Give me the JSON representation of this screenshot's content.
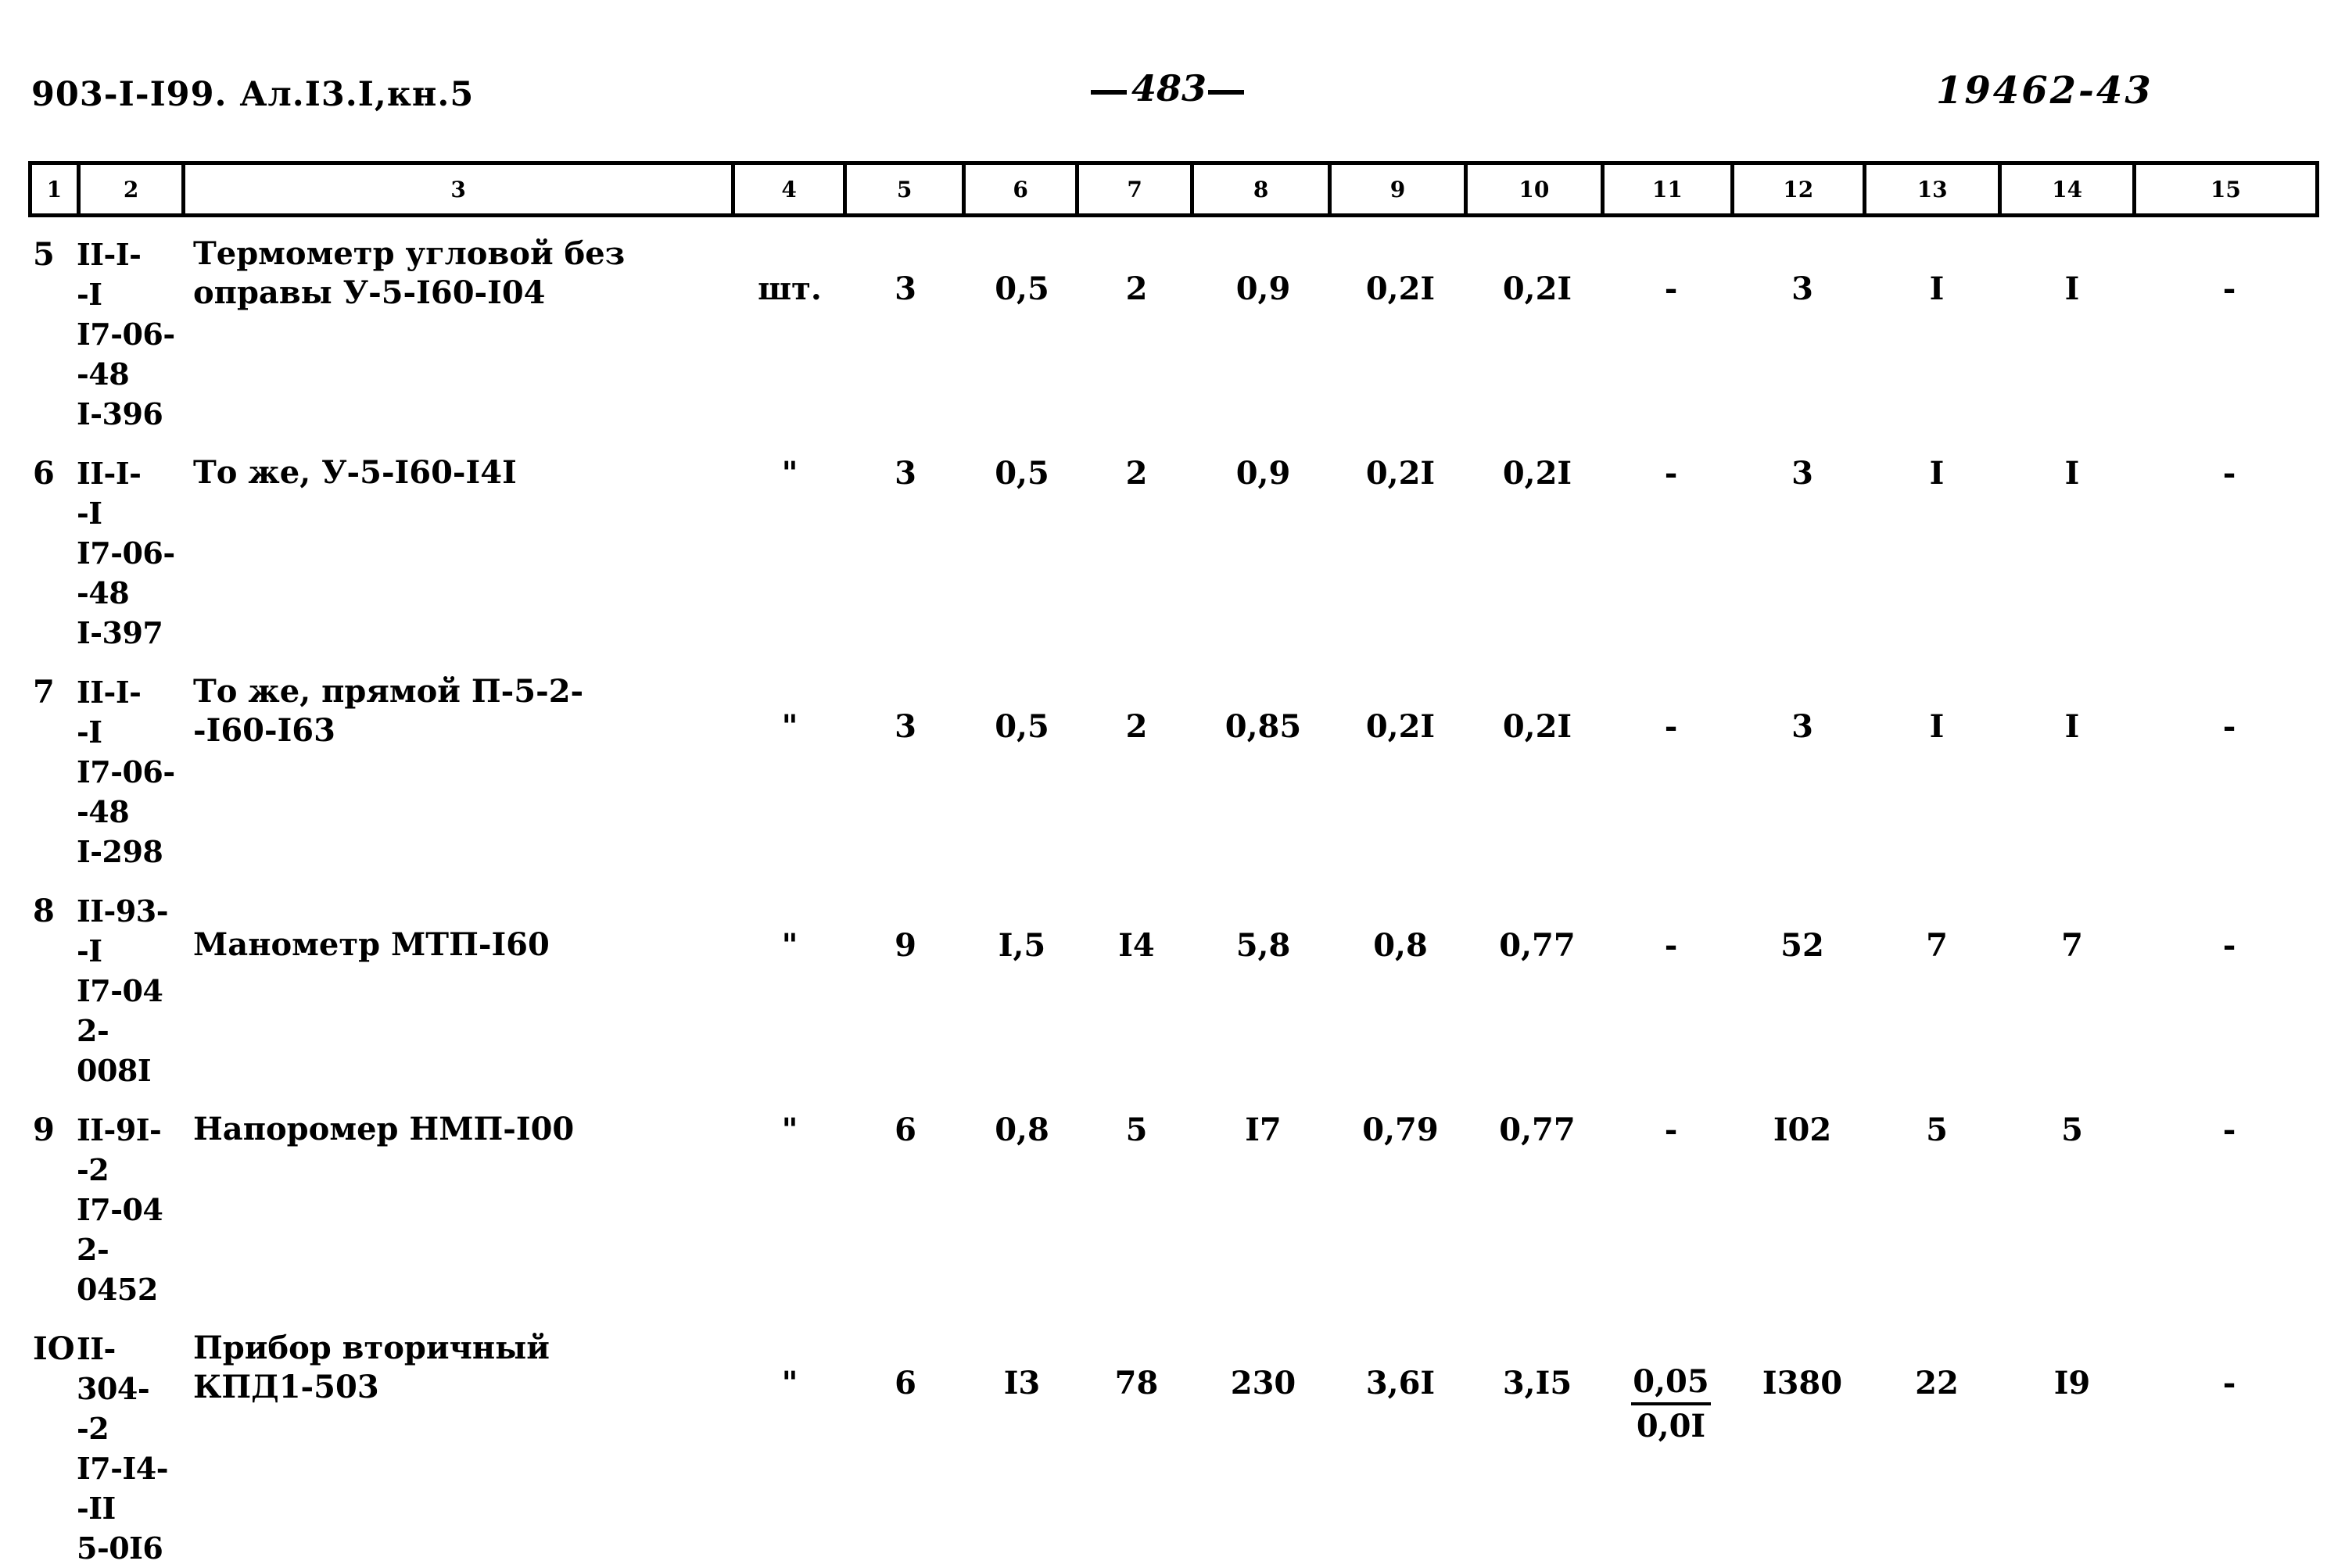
{
  "header": {
    "doc_code": "903-I-I99. Ал.I3.I,кн.5",
    "page_number": "483",
    "archive_number": "19462-43"
  },
  "table": {
    "column_headers": [
      "1",
      "2",
      "3",
      "4",
      "5",
      "6",
      "7",
      "8",
      "9",
      "10",
      "11",
      "12",
      "13",
      "14",
      "15"
    ],
    "rows": [
      {
        "pos": "5",
        "code": "II-I-\n-I\nI7-06-\n-48\nI-396",
        "name": "Термометр угловой без\nоправы У-5-I60-I04",
        "unit": "шт.",
        "c5": "3",
        "c6": "0,5",
        "c7": "2",
        "c8": "0,9",
        "c9": "0,2I",
        "c10": "0,2I",
        "c11": "-",
        "c12": "3",
        "c13": "I",
        "c14": "I",
        "c15": "-"
      },
      {
        "pos": "6",
        "code": "II-I-\n-I\nI7-06-\n-48\nI-397",
        "name": "То же, У-5-I60-I4I",
        "unit": "\"",
        "c5": "3",
        "c6": "0,5",
        "c7": "2",
        "c8": "0,9",
        "c9": "0,2I",
        "c10": "0,2I",
        "c11": "-",
        "c12": "3",
        "c13": "I",
        "c14": "I",
        "c15": "-"
      },
      {
        "pos": "7",
        "code": "II-I-\n-I\nI7-06-\n-48\nI-298",
        "name": "То же, прямой П-5-2-\n-I60-I63",
        "unit": "\"",
        "c5": "3",
        "c6": "0,5",
        "c7": "2",
        "c8": "0,85",
        "c9": "0,2I",
        "c10": "0,2I",
        "c11": "-",
        "c12": "3",
        "c13": "I",
        "c14": "I",
        "c15": "-"
      },
      {
        "pos": "8",
        "code": "II-93-\n-I\nI7-04\n2-008I",
        "name": "Манометр МТП-I60",
        "unit": "\"",
        "c5": "9",
        "c6": "I,5",
        "c7": "I4",
        "c8": "5,8",
        "c9": "0,8",
        "c10": "0,77",
        "c11": "-",
        "c12": "52",
        "c13": "7",
        "c14": "7",
        "c15": "-"
      },
      {
        "pos": "9",
        "code": "II-9I-\n-2\nI7-04\n2-0452",
        "name": "Напоромер НМП-I00",
        "unit": "\"",
        "c5": "6",
        "c6": "0,8",
        "c7": "5",
        "c8": "I7",
        "c9": "0,79",
        "c10": "0,77",
        "c11": "-",
        "c12": "I02",
        "c13": "5",
        "c14": "5",
        "c15": "-"
      },
      {
        "pos": "IO",
        "code": "II-304-\n-2\nI7-I4-\n-II\n5-0I6",
        "name": "Прибор вторичный\nКПД1-503",
        "unit": "\"",
        "c5": "6",
        "c6": "I3",
        "c7": "78",
        "c8": "230",
        "c9": "3,6I",
        "c10": "3,I5",
        "c11_fraction": {
          "numerator": "0,05",
          "denominator": "0,0I"
        },
        "c12": "I380",
        "c13": "22",
        "c14": "I9",
        "c15": "-"
      }
    ]
  }
}
